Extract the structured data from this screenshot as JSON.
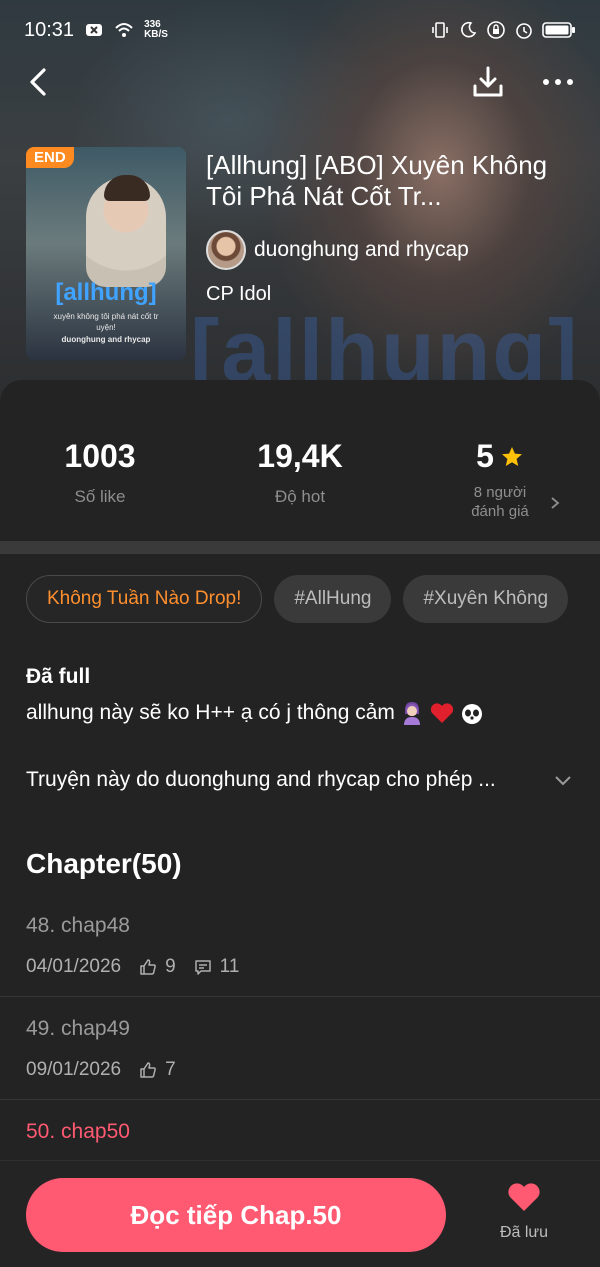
{
  "status_bar": {
    "time": "10:31",
    "net_speed_value": "336",
    "net_speed_unit": "KB/S"
  },
  "book": {
    "badge": "END",
    "title": "[Allhung] [ABO] Xuyên Không Tôi Phá Nát Cốt Tr...",
    "authors": "duonghung and rhycap",
    "category": "CP Idol",
    "cover_title": "[allhung]",
    "cover_line1": "xuyên không tôi phá nát cốt tr",
    "cover_line2": "uyện!",
    "cover_line3": "duonghung and rhycap",
    "hero_ghost_text": "[allhung]"
  },
  "stats": {
    "likes_value": "1003",
    "likes_label": "Số like",
    "hot_value": "19,4K",
    "hot_label": "Độ hot",
    "rating_value": "5",
    "rating_label_line1": "8 người",
    "rating_label_line2": "đánh giá"
  },
  "tags": [
    "Không Tuần Nào Drop!",
    "#AllHung",
    "#Xuyên Không"
  ],
  "description": {
    "status": "Đã full",
    "line": "allhung này sẽ ko H++ ạ có j thông cảm",
    "permission": "Truyện này do duonghung and rhycap  cho phép ..."
  },
  "chapters": {
    "header": "Chapter(50)",
    "items": [
      {
        "title": "48. chap48",
        "date": "04/01/2026",
        "likes": "9",
        "comments": "11"
      },
      {
        "title": "49. chap49",
        "date": "09/01/2026",
        "likes": "7"
      },
      {
        "title": "50. chap50"
      }
    ]
  },
  "bottom": {
    "read_button": "Đọc tiếp Chap.50",
    "saved_label": "Đã lưu"
  },
  "colors": {
    "accent": "#ff5a72",
    "tag_orange": "#ff8f2e",
    "star": "#ffc107",
    "end_badge": "#ff8a1f"
  }
}
